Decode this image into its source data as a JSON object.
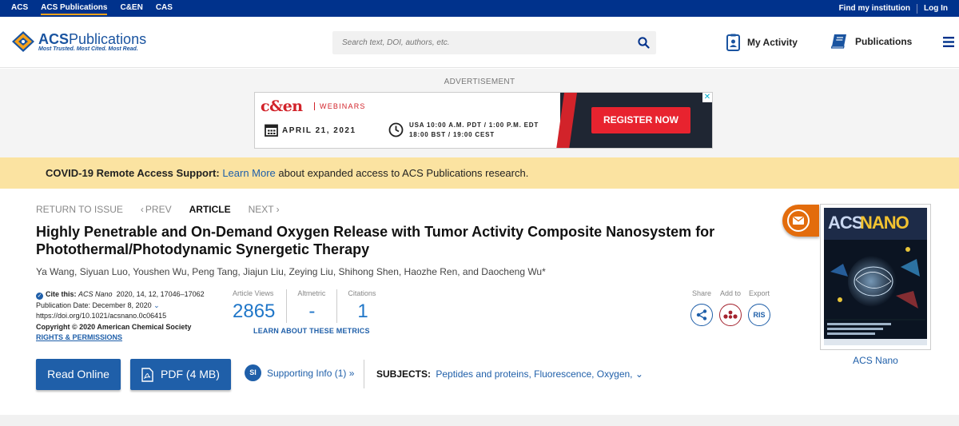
{
  "topbar": {
    "links": [
      "ACS",
      "ACS Publications",
      "C&EN",
      "CAS"
    ],
    "find_institution": "Find my institution",
    "login": "Log In"
  },
  "header": {
    "logo_title_1": "ACS",
    "logo_title_2": "Publications",
    "logo_tagline": "Most Trusted. Most Cited. Most Read.",
    "search_placeholder": "Search text, DOI, authors, etc.",
    "my_activity": "My Activity",
    "publications": "Publications"
  },
  "ad": {
    "label": "ADVERTISEMENT",
    "brand": "c&en",
    "brand_sub": "WEBINARS",
    "date": "APRIL 21, 2021",
    "time_line1": "USA 10:00 A.M. PDT / 1:00 P.M. EDT",
    "time_line2": "18:00 BST / 19:00 CEST",
    "cta": "REGISTER NOW"
  },
  "covid": {
    "bold": "COVID-19 Remote Access Support:",
    "link": "Learn More",
    "rest": "about expanded access to ACS Publications research."
  },
  "nav": {
    "return": "RETURN TO ISSUE",
    "prev": "PREV",
    "current": "ARTICLE",
    "next": "NEXT"
  },
  "article": {
    "title": "Highly Penetrable and On-Demand Oxygen Release with Tumor Activity Composite Nanosystem for Photothermal/Photodynamic Synergetic Therapy",
    "authors": "Ya Wang, Siyuan Luo, Youshen Wu, Peng Tang, Jiajun Liu, Zeying Liu, Shihong Shen, Haozhe Ren, and Daocheng Wu*",
    "cite_label": "Cite this:",
    "cite_journal": "ACS Nano",
    "cite_ref": "2020, 14, 12, 17046–17062",
    "pub_date": "Publication Date: December 8, 2020",
    "doi": "https://doi.org/10.1021/acsnano.0c06415",
    "copyright": "Copyright © 2020 American Chemical Society",
    "rights": "RIGHTS & PERMISSIONS"
  },
  "metrics": {
    "views_label": "Article Views",
    "views_value": "2865",
    "altmetric_label": "Altmetric",
    "altmetric_value": "-",
    "citations_label": "Citations",
    "citations_value": "1",
    "learn_more": "LEARN ABOUT THESE METRICS"
  },
  "tools": {
    "share": "Share",
    "add_to": "Add to",
    "export": "Export",
    "ris": "RIS"
  },
  "actions": {
    "read_online": "Read Online",
    "pdf": "PDF (4 MB)",
    "si_badge": "SI",
    "supporting_info": "Supporting Info (1) »",
    "subjects_label": "SUBJECTS:",
    "subjects": "Peptides and proteins, Fluorescence, Oxygen,"
  },
  "cover": {
    "caption": "ACS Nano"
  },
  "colors": {
    "topbar": "#00328c",
    "link_blue": "#1f5fa9",
    "banner_yellow": "#fbe3a1",
    "ad_red": "#d2232a",
    "mail_orange": "#e36c0c"
  }
}
